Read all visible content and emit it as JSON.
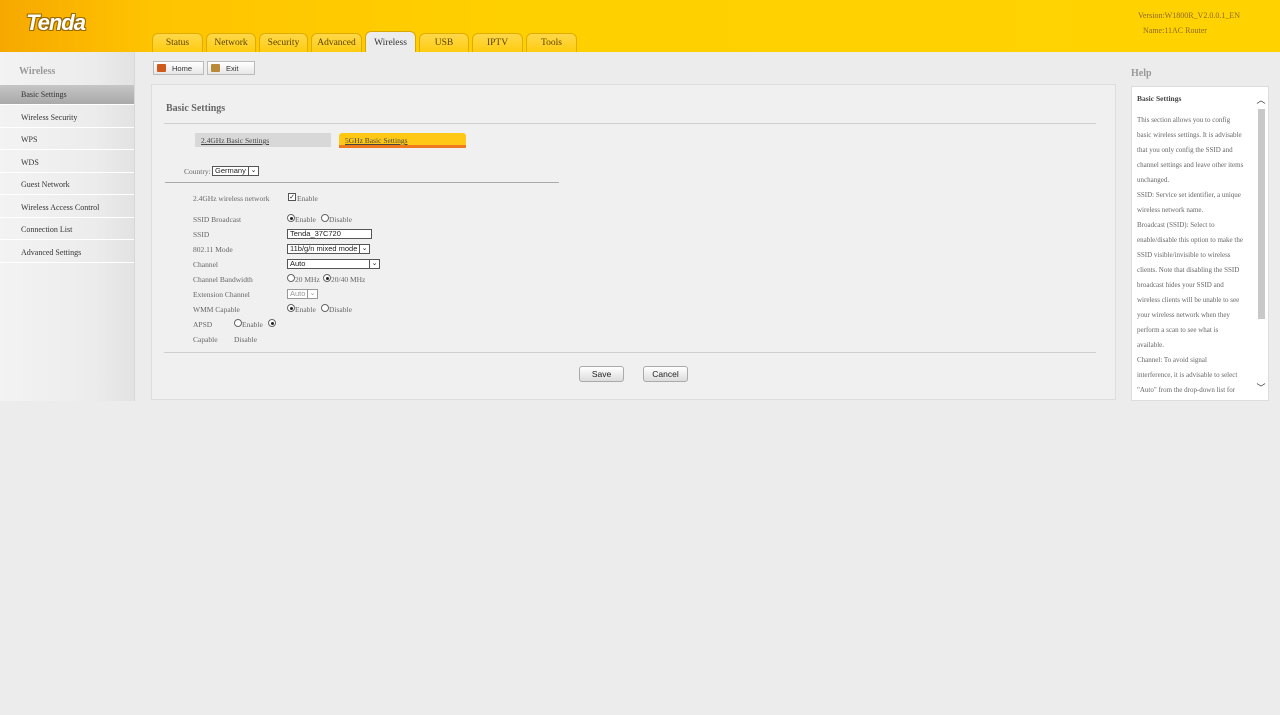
{
  "header": {
    "logo": "Tenda",
    "version": "Version:W1800R_V2.0.0.1_EN",
    "device_name": "Name:11AC Router",
    "tabs": [
      "Status",
      "Network",
      "Security",
      "Advanced",
      "Wireless",
      "USB",
      "IPTV",
      "Tools"
    ],
    "active_tab": "Wireless"
  },
  "toolbar": {
    "home_label": "Home",
    "exit_label": "Exit"
  },
  "sidebar": {
    "title": "Wireless",
    "items": [
      "Basic Settings",
      "Wireless Security",
      "WPS",
      "WDS",
      "Guest Network",
      "Wireless Access Control",
      "Connection List",
      "Advanced Settings"
    ],
    "active_item": "Basic Settings"
  },
  "main": {
    "title": "Basic Settings",
    "band_tabs": [
      "2.4GHz Basic Settings",
      "5GHz Basic Settings"
    ],
    "active_band": "5GHz Basic Settings",
    "country_label": "Country:",
    "country_value": "Germany",
    "fields": {
      "network_label": "2.4GHz wireless network",
      "network_enable": "Enable",
      "ssid_broadcast_label": "SSID Broadcast",
      "ssid_broadcast_enable": "Enable",
      "ssid_broadcast_disable": "Disable",
      "ssid_label": "SSID",
      "ssid_value": "Tenda_37C720",
      "mode_label": "802.11 Mode",
      "mode_value": "11b/g/n mixed mode",
      "channel_label": "Channel",
      "channel_value": "Auto",
      "bandwidth_label": "Channel Bandwidth",
      "bandwidth_20": "20 MHz",
      "bandwidth_2040": "20/40 MHz",
      "ext_channel_label": "Extension Channel",
      "ext_channel_value": "Auto",
      "wmm_label": "WMM Capable",
      "wmm_enable": "Enable",
      "wmm_disable": "Disable",
      "apsd_label_1": "APSD",
      "apsd_label_2": "Capable",
      "apsd_enable": "Enable",
      "apsd_disable": "Disable"
    },
    "save_label": "Save",
    "cancel_label": "Cancel"
  },
  "help": {
    "title": "Help",
    "heading": "Basic Settings",
    "body": "This section allows you to config\nbasic wireless settings. It is advisable\nthat you only config the SSID and\nchannel settings and leave other items\nunchanged.\nSSID: Service set identifier, a unique\nwireless network name.\nBroadcast (SSID): Select to\nenable/disable this option to make the\nSSID visible/invisible to wireless\nclients. Note that disabling the SSID\nbroadcast hides your SSID and\nwireless clients will be unable to see\nyour wireless network when they\nperform a scan to see what is\navailable.\nChannel: To avoid signal\ninterference, it is advisable to select\n\"Auto\" from the drop-down list for"
  }
}
